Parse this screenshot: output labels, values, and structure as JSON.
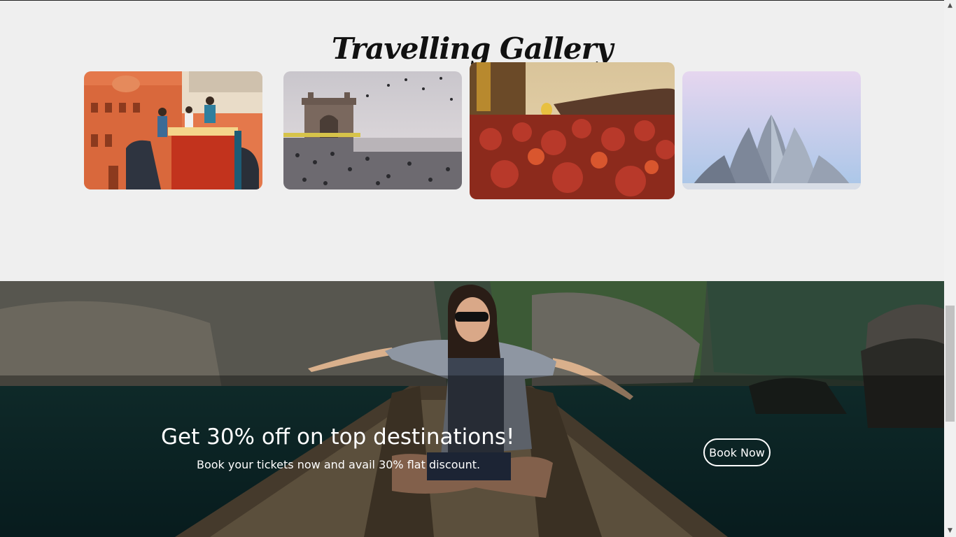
{
  "gallery": {
    "title": "Travelling Gallery",
    "images": [
      {
        "name": "rajasthan-palace-elephant"
      },
      {
        "name": "gateway-of-india-pigeons"
      },
      {
        "name": "holi-festival-crowd"
      },
      {
        "name": "lotus-temple"
      }
    ]
  },
  "promo": {
    "heading": "Get 30% off on top destinations!",
    "subtext": "Book your tickets now and avail 30% flat discount.",
    "button_label": "Book Now"
  },
  "scrollbar": {
    "up_icon": "▲",
    "down_icon": "▼"
  }
}
